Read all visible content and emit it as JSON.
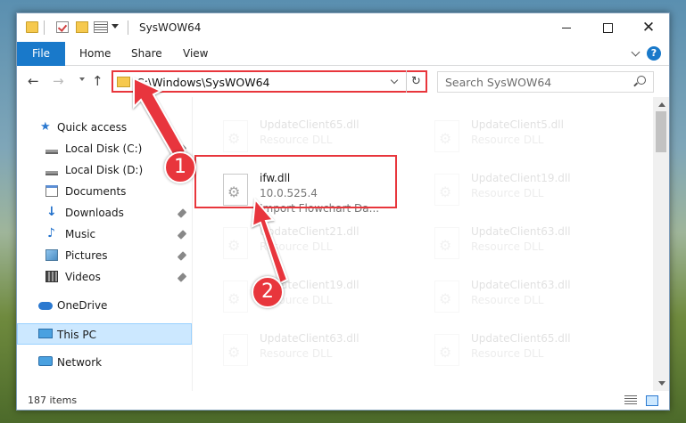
{
  "window": {
    "title": "SysWOW64"
  },
  "ribbon": {
    "tabs": {
      "file": "File",
      "home": "Home",
      "share": "Share",
      "view": "View"
    },
    "help": "?"
  },
  "address": {
    "path": "C:\\Windows\\SysWOW64",
    "refresh": "↻"
  },
  "search": {
    "placeholder": "Search SysWOW64"
  },
  "nav": {
    "back": "←",
    "forward": "→",
    "up": "↑"
  },
  "sidebar": {
    "quick_access": "Quick access",
    "items": [
      {
        "label": "Local Disk (C:)"
      },
      {
        "label": "Local Disk (D:)"
      },
      {
        "label": "Documents"
      },
      {
        "label": "Downloads"
      },
      {
        "label": "Music"
      },
      {
        "label": "Pictures"
      },
      {
        "label": "Videos"
      }
    ],
    "onedrive": "OneDrive",
    "this_pc": "This PC",
    "network": "Network"
  },
  "files": [
    {
      "name": "UpdateClient65.dll",
      "type": "Resource DLL"
    },
    {
      "name": "UpdateClient5.dll",
      "type": "Resource DLL"
    },
    {
      "name": "UpdateClient19.dll",
      "type": "Resource DLL"
    },
    {
      "name": "UpdateClient21.dll",
      "type": "Resource DLL"
    },
    {
      "name": "UpdateClient63.dll",
      "type": "Resource DLL"
    },
    {
      "name": "UpdateClient19.dll",
      "type": "Resource DLL"
    },
    {
      "name": "UpdateClient63.dll",
      "type": "Resource DLL"
    },
    {
      "name": "UpdateClient63.dll",
      "type": "Resource DLL"
    },
    {
      "name": "UpdateClient65.dll",
      "type": "Resource DLL"
    }
  ],
  "highlighted_file": {
    "name": "ifw.dll",
    "version": "10.0.525.4",
    "description": "Import Flowchart Da..."
  },
  "status": {
    "item_count": "187 items"
  },
  "annotations": {
    "step1": "1",
    "step2": "2",
    "color": "#e8363c"
  }
}
